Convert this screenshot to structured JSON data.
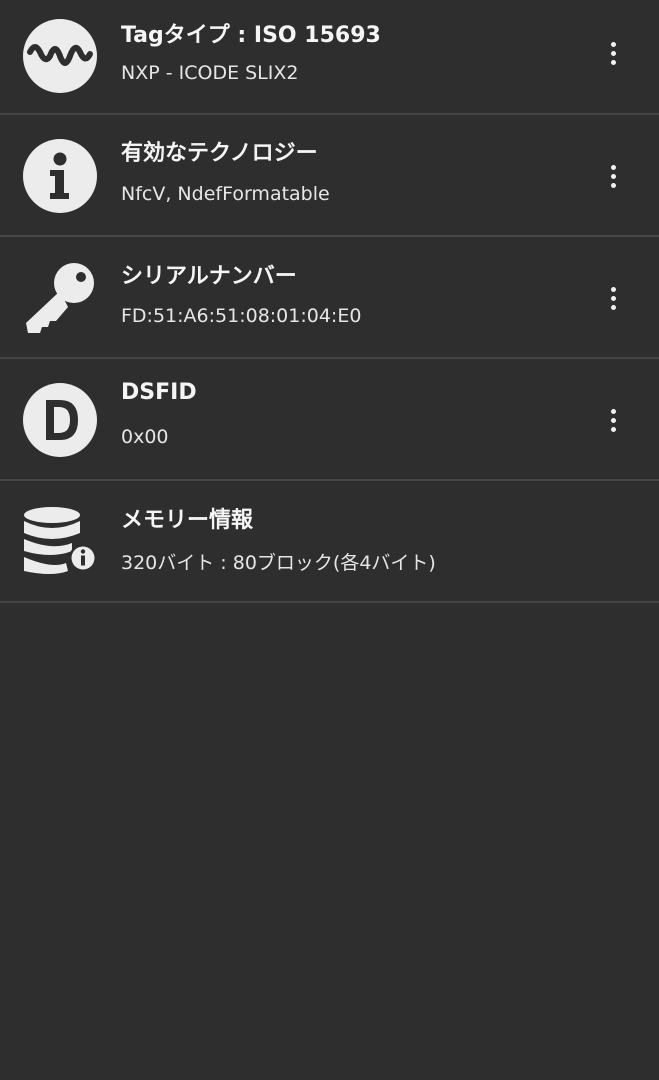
{
  "items": [
    {
      "title": "Tagタイプ : ISO 15693",
      "subtitle": "NXP - ICODE SLIX2",
      "icon": "tag-wave-icon"
    },
    {
      "title": "有効なテクノロジー",
      "subtitle": "NfcV, NdefFormatable",
      "icon": "info-icon"
    },
    {
      "title": "シリアルナンバー",
      "subtitle": "FD:51:A6:51:08:01:04:E0",
      "icon": "key-icon"
    },
    {
      "title": "DSFID",
      "subtitle": "0x00",
      "icon": "letter-d-icon"
    },
    {
      "title": "メモリー情報",
      "subtitle": "320バイト : 80ブロック(各4バイト)",
      "icon": "database-info-icon"
    }
  ],
  "colors": {
    "background": "#2e2e2e",
    "divider": "#454545",
    "text": "#f0f0f0"
  }
}
